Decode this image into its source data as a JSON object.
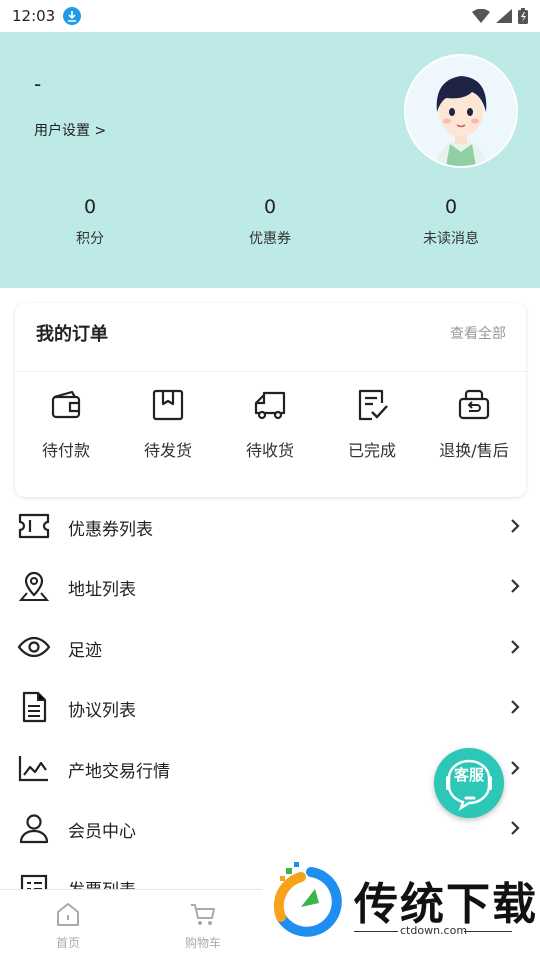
{
  "status_bar": {
    "time": "12:03"
  },
  "profile": {
    "nickname": "-",
    "settings_link": "用户设置 >"
  },
  "stats": [
    {
      "value": "0",
      "label": "积分"
    },
    {
      "value": "0",
      "label": "优惠券"
    },
    {
      "value": "0",
      "label": "未读消息"
    }
  ],
  "orders": {
    "title": "我的订单",
    "view_all": "查看全部",
    "items": [
      {
        "label": "待付款",
        "icon": "wallet-icon"
      },
      {
        "label": "待发货",
        "icon": "package-icon"
      },
      {
        "label": "待收货",
        "icon": "truck-icon"
      },
      {
        "label": "已完成",
        "icon": "checklist-icon"
      },
      {
        "label": "退换/售后",
        "icon": "return-icon"
      }
    ]
  },
  "menu": [
    {
      "label": "优惠券列表",
      "icon": "ticket-icon"
    },
    {
      "label": "地址列表",
      "icon": "location-pin-icon"
    },
    {
      "label": "足迹",
      "icon": "eye-icon"
    },
    {
      "label": "协议列表",
      "icon": "document-icon"
    },
    {
      "label": "产地交易行情",
      "icon": "line-chart-icon"
    },
    {
      "label": "会员中心",
      "icon": "user-icon"
    },
    {
      "label": "发票列表",
      "icon": "invoice-icon"
    }
  ],
  "floating_service": {
    "label": "客服"
  },
  "bottom_nav": [
    {
      "label": "首页",
      "icon": "home-icon"
    },
    {
      "label": "购物车",
      "icon": "cart-icon"
    }
  ],
  "watermark": {
    "brand": "传统下载",
    "url": "ctdown.com"
  },
  "colors": {
    "header_bg": "#bdeae6",
    "service_accent": "#2dc7b7"
  }
}
